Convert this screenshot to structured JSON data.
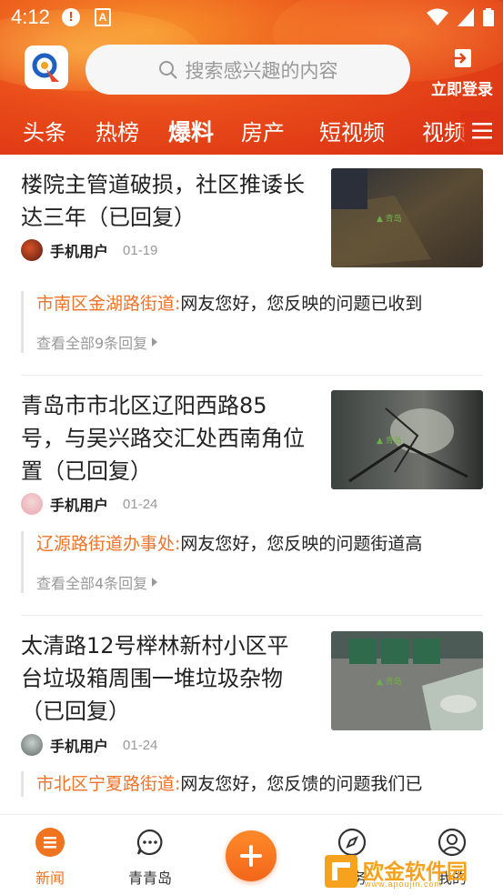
{
  "status_bar": {
    "time": "4:12"
  },
  "header": {
    "search_placeholder": "搜索感兴趣的内容",
    "login_label": "立即登录"
  },
  "tabs": [
    {
      "label": "头条"
    },
    {
      "label": "热榜"
    },
    {
      "label": "爆料",
      "active": true
    },
    {
      "label": "房产"
    },
    {
      "label": "短视频"
    },
    {
      "label": "视频"
    }
  ],
  "feed": [
    {
      "title": "楼院主管道破损，社区推诿长达三年（已回复）",
      "user": "手机用户",
      "date": "01-19",
      "reply_org": "市南区金湖路街道:",
      "reply_text": "网友您好，您反映的问题已收到",
      "more": "查看全部9条回复"
    },
    {
      "title": "青岛市市北区辽阳西路85号，与吴兴路交汇处西南角位置（已回复）",
      "user": "手机用户",
      "date": "01-24",
      "reply_org": "辽源路街道办事处:",
      "reply_text": "网友您好，您反映的问题街道高",
      "more": "查看全部4条回复"
    },
    {
      "title": "太清路12号榉林新村小区平台垃圾箱周围一堆垃圾杂物（已回复）",
      "user": "手机用户",
      "date": "01-24",
      "reply_org": "市北区宁夏路街道:",
      "reply_text": "网友您好，您反馈的问题我们已"
    }
  ],
  "bottom_nav": [
    {
      "label": "新闻",
      "active": true
    },
    {
      "label": "青青岛"
    },
    {
      "label": "服务"
    },
    {
      "label": "我的"
    }
  ],
  "watermark": {
    "text": "欧金软件园",
    "url": "www.apoujin.com"
  },
  "colors": {
    "accent": "#ef7327",
    "header_red": "#dc3414"
  }
}
